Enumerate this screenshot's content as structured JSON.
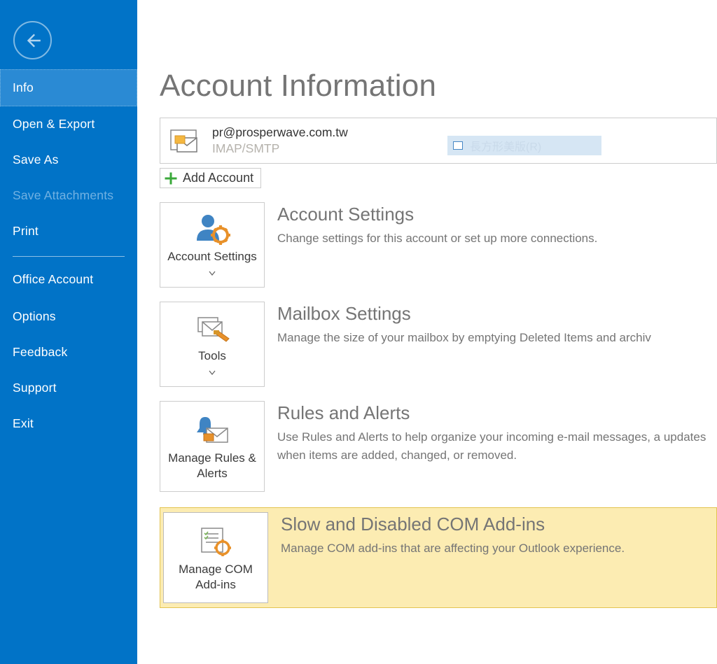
{
  "sidebar": {
    "items": [
      {
        "label": "Info",
        "selected": true,
        "disabled": false
      },
      {
        "label": "Open & Export",
        "selected": false,
        "disabled": false
      },
      {
        "label": "Save As",
        "selected": false,
        "disabled": false
      },
      {
        "label": "Save Attachments",
        "selected": false,
        "disabled": true
      },
      {
        "label": "Print",
        "selected": false,
        "disabled": false
      },
      {
        "label": "Office Account",
        "selected": false,
        "disabled": false
      },
      {
        "label": "Options",
        "selected": false,
        "disabled": false
      },
      {
        "label": "Feedback",
        "selected": false,
        "disabled": false
      },
      {
        "label": "Support",
        "selected": false,
        "disabled": false
      },
      {
        "label": "Exit",
        "selected": false,
        "disabled": false
      }
    ]
  },
  "main": {
    "title": "Account Information",
    "account": {
      "email": "pr@prosperwave.com.tw",
      "type": "IMAP/SMTP",
      "highlight_text": "長方形美版(R)"
    },
    "add_account_label": "Add Account",
    "sections": [
      {
        "tile_label": "Account Settings",
        "tile_dropdown": true,
        "title": "Account Settings",
        "desc": "Change settings for this account or set up more connections."
      },
      {
        "tile_label": "Tools",
        "tile_dropdown": true,
        "title": "Mailbox Settings",
        "desc": "Manage the size of your mailbox by emptying Deleted Items and archiv"
      },
      {
        "tile_label": "Manage Rules & Alerts",
        "tile_dropdown": false,
        "title": "Rules and Alerts",
        "desc": "Use Rules and Alerts to help organize your incoming e-mail messages, a updates when items are added, changed, or removed."
      },
      {
        "tile_label": "Manage COM Add-ins",
        "tile_dropdown": false,
        "title": "Slow and Disabled COM Add-ins",
        "desc": "Manage COM add-ins that are affecting your Outlook experience.",
        "highlight": true
      }
    ]
  }
}
